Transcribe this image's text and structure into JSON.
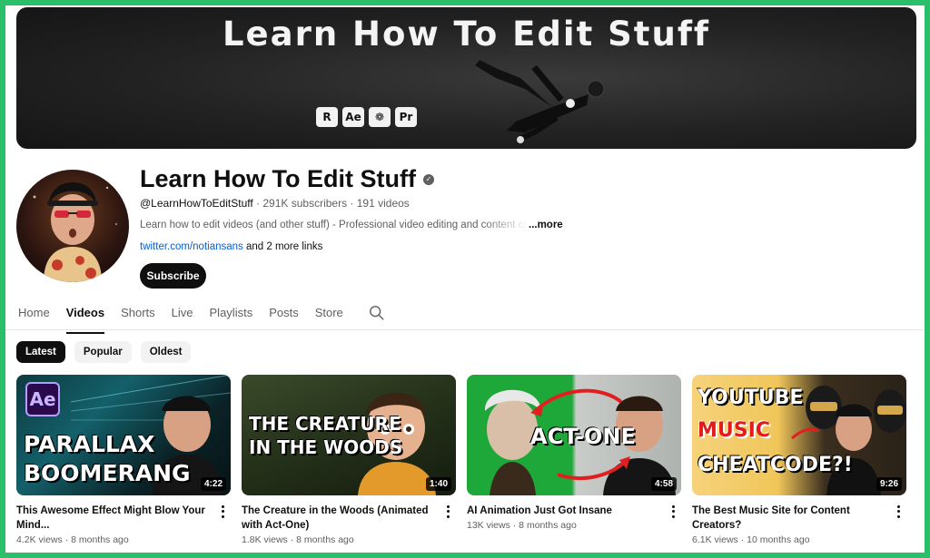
{
  "banner": {
    "title": "Learn How To Edit Stuff",
    "app_icons": [
      "R",
      "Ae",
      "❁",
      "Pr"
    ]
  },
  "channel": {
    "name": "Learn How To Edit Stuff",
    "handle": "@LearnHowToEditStuff",
    "stats": "· 291K subscribers · 191 videos",
    "description": "Learn how to edit videos (and other stuff) - Professional video editing and content creation",
    "more_label": "...more",
    "link": "twitter.com/notiansans",
    "more_links": " and 2 more links",
    "subscribe_label": "Subscribe"
  },
  "tabs": [
    {
      "label": "Home",
      "active": false
    },
    {
      "label": "Videos",
      "active": true
    },
    {
      "label": "Shorts",
      "active": false
    },
    {
      "label": "Live",
      "active": false
    },
    {
      "label": "Playlists",
      "active": false
    },
    {
      "label": "Posts",
      "active": false
    },
    {
      "label": "Store",
      "active": false
    }
  ],
  "chips": [
    {
      "label": "Latest",
      "active": true
    },
    {
      "label": "Popular",
      "active": false
    },
    {
      "label": "Oldest",
      "active": false
    }
  ],
  "videos": [
    {
      "title": "This Awesome Effect Might Blow Your Mind...",
      "stats": "4.2K views · 8 months ago",
      "duration": "4:22",
      "thumb_text": [
        "PARALLAX",
        "BOOMERANG"
      ],
      "badge": "Ae"
    },
    {
      "title": "The Creature in the Woods (Animated with Act-One)",
      "stats": "1.8K views · 8 months ago",
      "duration": "1:40",
      "thumb_text": [
        "THE CREATURE",
        "IN THE WOODS"
      ]
    },
    {
      "title": "AI Animation Just Got Insane",
      "stats": "13K views · 8 months ago",
      "duration": "4:58",
      "thumb_text": [
        "ACT-ONE"
      ]
    },
    {
      "title": "The Best Music Site for Content Creators?",
      "stats": "6.1K views · 10 months ago",
      "duration": "9:26",
      "thumb_text": [
        "YOUTUBE",
        "MUSIC",
        "CHEATCODE?!"
      ]
    }
  ],
  "colors": {
    "page_border": "#2bbf6a",
    "link": "#065fd4",
    "text_primary": "#0f0f0f",
    "text_secondary": "#606060"
  }
}
